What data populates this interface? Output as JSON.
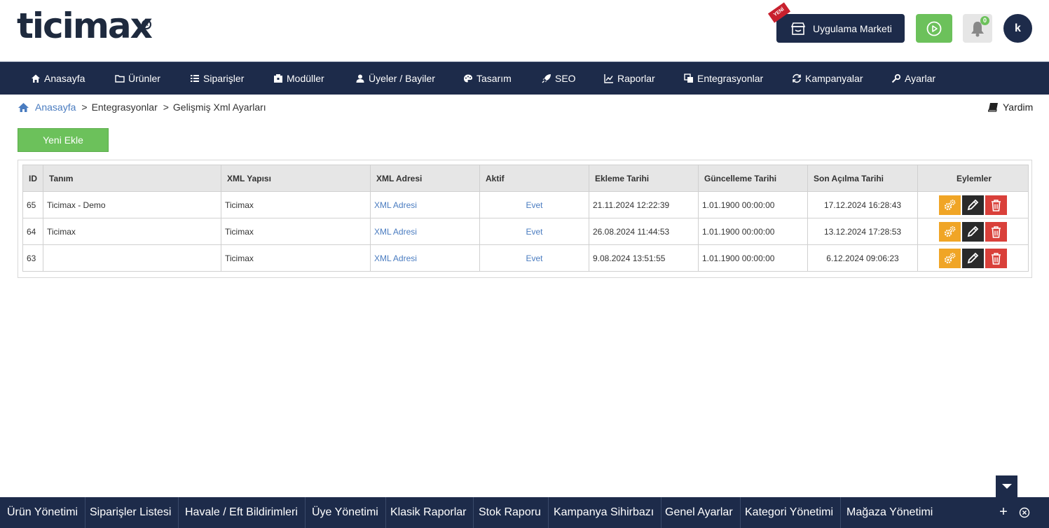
{
  "brand": {
    "logo_text": "ticimax"
  },
  "header": {
    "new_ribbon": "YENİ",
    "market_label": "Uygulama Marketi",
    "notification_count": "0",
    "avatar_letter": "k"
  },
  "nav": {
    "items": [
      {
        "label": "Anasayfa",
        "icon": "home-icon"
      },
      {
        "label": "Ürünler",
        "icon": "folder-icon"
      },
      {
        "label": "Siparişler",
        "icon": "list-icon"
      },
      {
        "label": "Modüller",
        "icon": "box-icon"
      },
      {
        "label": "Üyeler / Bayiler",
        "icon": "users-icon"
      },
      {
        "label": "Tasarım",
        "icon": "palette-icon"
      },
      {
        "label": "SEO",
        "icon": "rocket-icon"
      },
      {
        "label": "Raporlar",
        "icon": "chart-icon"
      },
      {
        "label": "Entegrasyonlar",
        "icon": "copy-icon"
      },
      {
        "label": "Kampanyalar",
        "icon": "refresh-icon"
      },
      {
        "label": "Ayarlar",
        "icon": "gear-icon"
      }
    ]
  },
  "breadcrumb": {
    "home": "Anasayfa",
    "sep1": ">",
    "level1": "Entegrasyonlar",
    "sep2": ">",
    "level2": "Gelişmiş Xml Ayarları"
  },
  "help_label": "Yardim",
  "add_button": "Yeni Ekle",
  "table": {
    "headers": {
      "id": "ID",
      "tanim": "Tanım",
      "xml_yapisi": "XML Yapısı",
      "xml_adresi": "XML Adresi",
      "aktif": "Aktif",
      "ekleme": "Ekleme Tarihi",
      "guncelleme": "Güncelleme Tarihi",
      "son_acilma": "Son Açılma Tarihi",
      "eylemler": "Eylemler"
    },
    "rows": [
      {
        "id": "65",
        "tanim": "Ticimax - Demo",
        "xml_yapisi": "Ticimax",
        "xml_adresi": "XML Adresi",
        "aktif": "Evet",
        "ekleme": "21.11.2024 12:22:39",
        "guncelleme": "1.01.1900 00:00:00",
        "son_acilma": "17.12.2024 16:28:43"
      },
      {
        "id": "64",
        "tanim": "Ticimax",
        "xml_yapisi": "Ticimax",
        "xml_adresi": "XML Adresi",
        "aktif": "Evet",
        "ekleme": "26.08.2024 11:44:53",
        "guncelleme": "1.01.1900 00:00:00",
        "son_acilma": "13.12.2024 17:28:53"
      },
      {
        "id": "63",
        "tanim": "",
        "xml_yapisi": "Ticimax",
        "xml_adresi": "XML Adresi",
        "aktif": "Evet",
        "ekleme": "9.08.2024 13:51:55",
        "guncelleme": "1.01.1900 00:00:00",
        "son_acilma": "6.12.2024 09:06:23"
      }
    ]
  },
  "bottom_bar": {
    "items": [
      "Ürün Yönetimi",
      "Siparişler Listesi",
      "Havale / Eft Bildirimleri",
      "Üye Yönetimi",
      "Klasik Raporlar",
      "Stok Raporu",
      "Kampanya Sihirbazı",
      "Genel Ayarlar",
      "Kategori Yönetimi",
      "Mağaza Yönetimi"
    ],
    "plus": "+"
  },
  "colors": {
    "navy": "#1d2b4a",
    "green": "#6cc15b",
    "link": "#4a7cc0",
    "gear_action": "#f0a526",
    "edit_action": "#2a2a2a",
    "delete_action": "#d9403a"
  }
}
